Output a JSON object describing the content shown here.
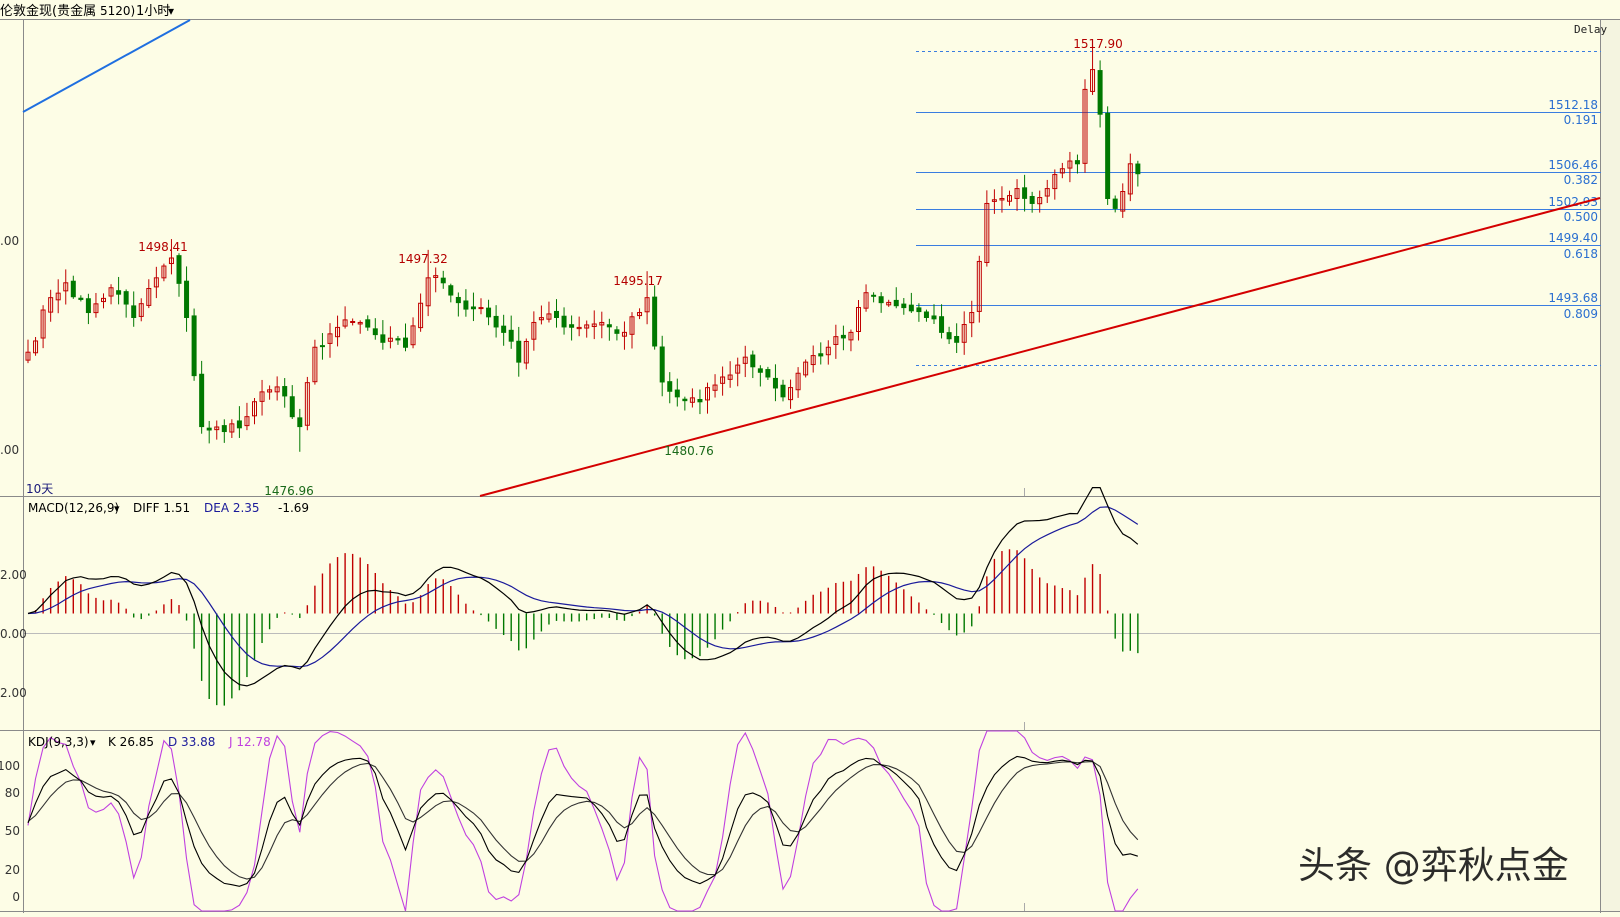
{
  "header": {
    "instrument": "伦敦金现(贵金属",
    "code": "5120)",
    "timeframe": "1小时",
    "timeframe_caret": "▾",
    "delay": "Delay"
  },
  "price_panel": {
    "y_tick_labels": [
      ".00",
      ".00"
    ],
    "range_label": "10天",
    "fib_levels": [
      {
        "price": "1512.18",
        "ratio": "0.191"
      },
      {
        "price": "1506.46",
        "ratio": "0.382"
      },
      {
        "price": "1502.93",
        "ratio": "0.500"
      },
      {
        "price": "1499.40",
        "ratio": "0.618"
      },
      {
        "price": "1493.68",
        "ratio": "0.809"
      }
    ],
    "swing_labels": [
      {
        "text": "1498.41",
        "kind": "high"
      },
      {
        "text": "1497.32",
        "kind": "high"
      },
      {
        "text": "1495.17",
        "kind": "high"
      },
      {
        "text": "1517.90",
        "kind": "high"
      },
      {
        "text": "1476.96",
        "kind": "low"
      },
      {
        "text": "1480.76",
        "kind": "low"
      }
    ]
  },
  "macd_panel": {
    "name": "MACD(12,26,9)",
    "caret": "▾",
    "diff_label": "DIFF 1.51",
    "dea_label": "DEA 2.35",
    "macd_value": "-1.69",
    "y_tick_labels": [
      "2.00",
      "0.00",
      "2.00"
    ]
  },
  "kdj_panel": {
    "name": "KDJ(9,3,3)",
    "caret": "▾",
    "k_label": "K 26.85",
    "d_label": "D 33.88",
    "j_label": "J 12.78",
    "y_tick_labels": [
      "100",
      "80",
      "50",
      "20",
      "0"
    ]
  },
  "watermark": "头条 @弈秋点金",
  "colors": {
    "background": "#fdfde6",
    "up": "#c00000",
    "down": "#007800",
    "fib": "#3a7de0",
    "trendline": "#d40000",
    "diff_line": "#000000",
    "dea_line": "#1a1a9a",
    "kdj_k": "#000000",
    "kdj_d": "#333333",
    "kdj_j": "#c040e0"
  },
  "chart_data": [
    {
      "type": "candlestick",
      "title": "",
      "ylim": [
        1472.5,
        1520.5
      ],
      "fib_retracement": {
        "high": 1517.9,
        "low": 1487.5,
        "levels": [
          {
            "ratio": 0.191,
            "price": 1512.18
          },
          {
            "ratio": 0.382,
            "price": 1506.46
          },
          {
            "ratio": 0.5,
            "price": 1502.93
          },
          {
            "ratio": 0.618,
            "price": 1499.4
          },
          {
            "ratio": 0.809,
            "price": 1493.68
          }
        ]
      },
      "annotated_extremes": [
        {
          "bar": 19,
          "value": 1498.41,
          "kind": "high"
        },
        {
          "bar": 36,
          "value": 1476.96,
          "kind": "low"
        },
        {
          "bar": 53,
          "value": 1497.32,
          "kind": "high"
        },
        {
          "bar": 82,
          "value": 1495.17,
          "kind": "high"
        },
        {
          "bar": 89,
          "value": 1480.76,
          "kind": "low"
        },
        {
          "bar": 141,
          "value": 1517.9,
          "kind": "high"
        }
      ],
      "anchors": [
        [
          0,
          1487.0
        ],
        [
          3,
          1492.5
        ],
        [
          5,
          1494.0
        ],
        [
          8,
          1491.0
        ],
        [
          11,
          1493.5
        ],
        [
          14,
          1490.5
        ],
        [
          17,
          1494.5
        ],
        [
          19,
          1496.5
        ],
        [
          21,
          1490.5
        ],
        [
          23,
          1479.5
        ],
        [
          26,
          1479.0
        ],
        [
          29,
          1480.5
        ],
        [
          31,
          1483.0
        ],
        [
          33,
          1483.5
        ],
        [
          35,
          1480.5
        ],
        [
          36,
          1479.5
        ],
        [
          38,
          1487.5
        ],
        [
          41,
          1489.5
        ],
        [
          44,
          1490.0
        ],
        [
          47,
          1488.0
        ],
        [
          50,
          1487.5
        ],
        [
          53,
          1494.5
        ],
        [
          55,
          1494.0
        ],
        [
          57,
          1492.0
        ],
        [
          60,
          1491.5
        ],
        [
          63,
          1489.0
        ],
        [
          65,
          1486.0
        ],
        [
          67,
          1490.0
        ],
        [
          70,
          1490.5
        ],
        [
          73,
          1489.5
        ],
        [
          76,
          1490.0
        ],
        [
          79,
          1489.0
        ],
        [
          81,
          1491.0
        ],
        [
          82,
          1492.5
        ],
        [
          84,
          1484.0
        ],
        [
          86,
          1482.5
        ],
        [
          89,
          1482.0
        ],
        [
          92,
          1484.5
        ],
        [
          95,
          1486.5
        ],
        [
          98,
          1484.5
        ],
        [
          100,
          1482.5
        ],
        [
          103,
          1486.0
        ],
        [
          106,
          1487.5
        ],
        [
          109,
          1489.0
        ],
        [
          111,
          1493.0
        ],
        [
          113,
          1492.0
        ],
        [
          116,
          1491.5
        ],
        [
          119,
          1490.5
        ],
        [
          121,
          1489.0
        ],
        [
          123,
          1488.0
        ],
        [
          125,
          1491.0
        ],
        [
          127,
          1502.0
        ],
        [
          129,
          1502.5
        ],
        [
          131,
          1503.5
        ],
        [
          133,
          1502.0
        ],
        [
          135,
          1503.5
        ],
        [
          137,
          1505.5
        ],
        [
          139,
          1506.0
        ],
        [
          140,
          1513.5
        ],
        [
          141,
          1515.5
        ],
        [
          142,
          1511.0
        ],
        [
          143,
          1502.5
        ],
        [
          144,
          1501.5
        ],
        [
          146,
          1506.0
        ],
        [
          147,
          1505.0
        ]
      ]
    },
    {
      "type": "bar+line",
      "title": "MACD(12,26,9)",
      "ylim": [
        -4.8,
        4.8
      ],
      "series": [
        {
          "name": "DIFF",
          "last": 1.51
        },
        {
          "name": "DEA",
          "last": 2.35
        },
        {
          "name": "MACD",
          "last": -1.69
        }
      ]
    },
    {
      "type": "line",
      "title": "KDJ(9,3,3)",
      "ylim": [
        -5,
        105
      ],
      "series": [
        {
          "name": "K",
          "last": 26.85
        },
        {
          "name": "D",
          "last": 33.88
        },
        {
          "name": "J",
          "last": 12.78
        }
      ]
    }
  ]
}
